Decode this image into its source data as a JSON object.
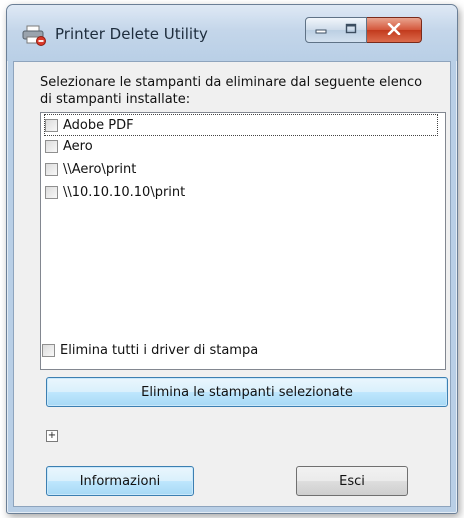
{
  "window": {
    "title": "Printer Delete Utility",
    "colors": {
      "frame": "#b9cfe6",
      "close": "#c23a1d",
      "default_button": "#a7d9f5"
    }
  },
  "instructions": "Selezionare le stampanti da eliminare dal seguente elenco di stampanti installate:",
  "printers": [
    {
      "label": "Adobe PDF",
      "checked": false
    },
    {
      "label": "Aero",
      "checked": false
    },
    {
      "label": "\\\\Aero\\print",
      "checked": false
    },
    {
      "label": "\\\\10.10.10.10\\print",
      "checked": false
    }
  ],
  "delete_all_drivers": {
    "label": "Elimina tutti i driver di stampa",
    "checked": false
  },
  "buttons": {
    "delete_selected": "Elimina le stampanti selezionate",
    "expand": "+",
    "info": "Informazioni",
    "exit": "Esci"
  },
  "icons": {
    "app": "printer-delete-icon",
    "minimize": "minimize-icon",
    "maximize": "maximize-icon",
    "close": "close-icon"
  }
}
